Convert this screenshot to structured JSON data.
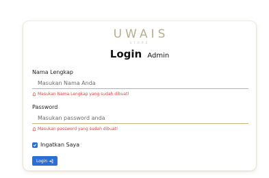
{
  "brand": {
    "name": "UWAIS",
    "sub": "STORE"
  },
  "header": {
    "title": "Login",
    "subtitle": "Admin"
  },
  "form": {
    "name_label": "Nama Lengkap",
    "name_placeholder": "Masukan Nama Anda",
    "name_error": "Masukan Nama Lengkap yang sudah dibuat!",
    "password_label": "Password",
    "password_placeholder": "Masukan password anda",
    "password_error": "Masukan password yang sudah dibuat!",
    "remember_label": "Ingatkan Saya",
    "remember_checked": true,
    "login_label": "Login"
  },
  "colors": {
    "accent": "#2b6fd6",
    "error": "#e04040",
    "underline": "#c8b27a",
    "brand": "#b9ad8f"
  }
}
